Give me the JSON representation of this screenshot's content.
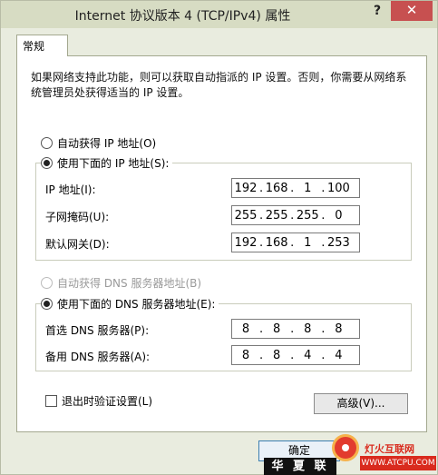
{
  "window": {
    "title": "Internet 协议版本 4 (TCP/IPv4) 属性",
    "help_label": "?",
    "close_label": "✕"
  },
  "tab": {
    "label": "常规"
  },
  "description": "如果网络支持此功能，则可以获取自动指派的 IP 设置。否则，你需要从网络系统管理员处获得适当的 IP 设置。",
  "ip_section": {
    "auto_label": "自动获得 IP 地址(O)",
    "auto_selected": false,
    "manual_label": "使用下面的 IP 地址(S):",
    "manual_selected": true,
    "fields": [
      {
        "label": "IP 地址(I):",
        "octets": [
          "192",
          "168",
          "1",
          "100"
        ]
      },
      {
        "label": "子网掩码(U):",
        "octets": [
          "255",
          "255",
          "255",
          "0"
        ]
      },
      {
        "label": "默认网关(D):",
        "octets": [
          "192",
          "168",
          "1",
          "253"
        ]
      }
    ]
  },
  "dns_section": {
    "auto_label": "自动获得 DNS 服务器地址(B)",
    "auto_selected": false,
    "auto_disabled": true,
    "manual_label": "使用下面的 DNS 服务器地址(E):",
    "manual_selected": true,
    "fields": [
      {
        "label": "首选 DNS 服务器(P):",
        "octets": [
          "8",
          "8",
          "8",
          "8"
        ]
      },
      {
        "label": "备用 DNS 服务器(A):",
        "octets": [
          "8",
          "8",
          "4",
          "4"
        ]
      }
    ]
  },
  "validate_label": "退出时验证设置(L)",
  "validate_checked": false,
  "advanced_label": "高级(V)...",
  "ok_label": "确定",
  "watermark": {
    "left_text": "华 夏 联 盟",
    "right_text": "灯火互联网",
    "url": "WWW.ATCPU.COM"
  },
  "colors": {
    "close_button": "#c75050",
    "titlebar": "#d7dcc3"
  }
}
